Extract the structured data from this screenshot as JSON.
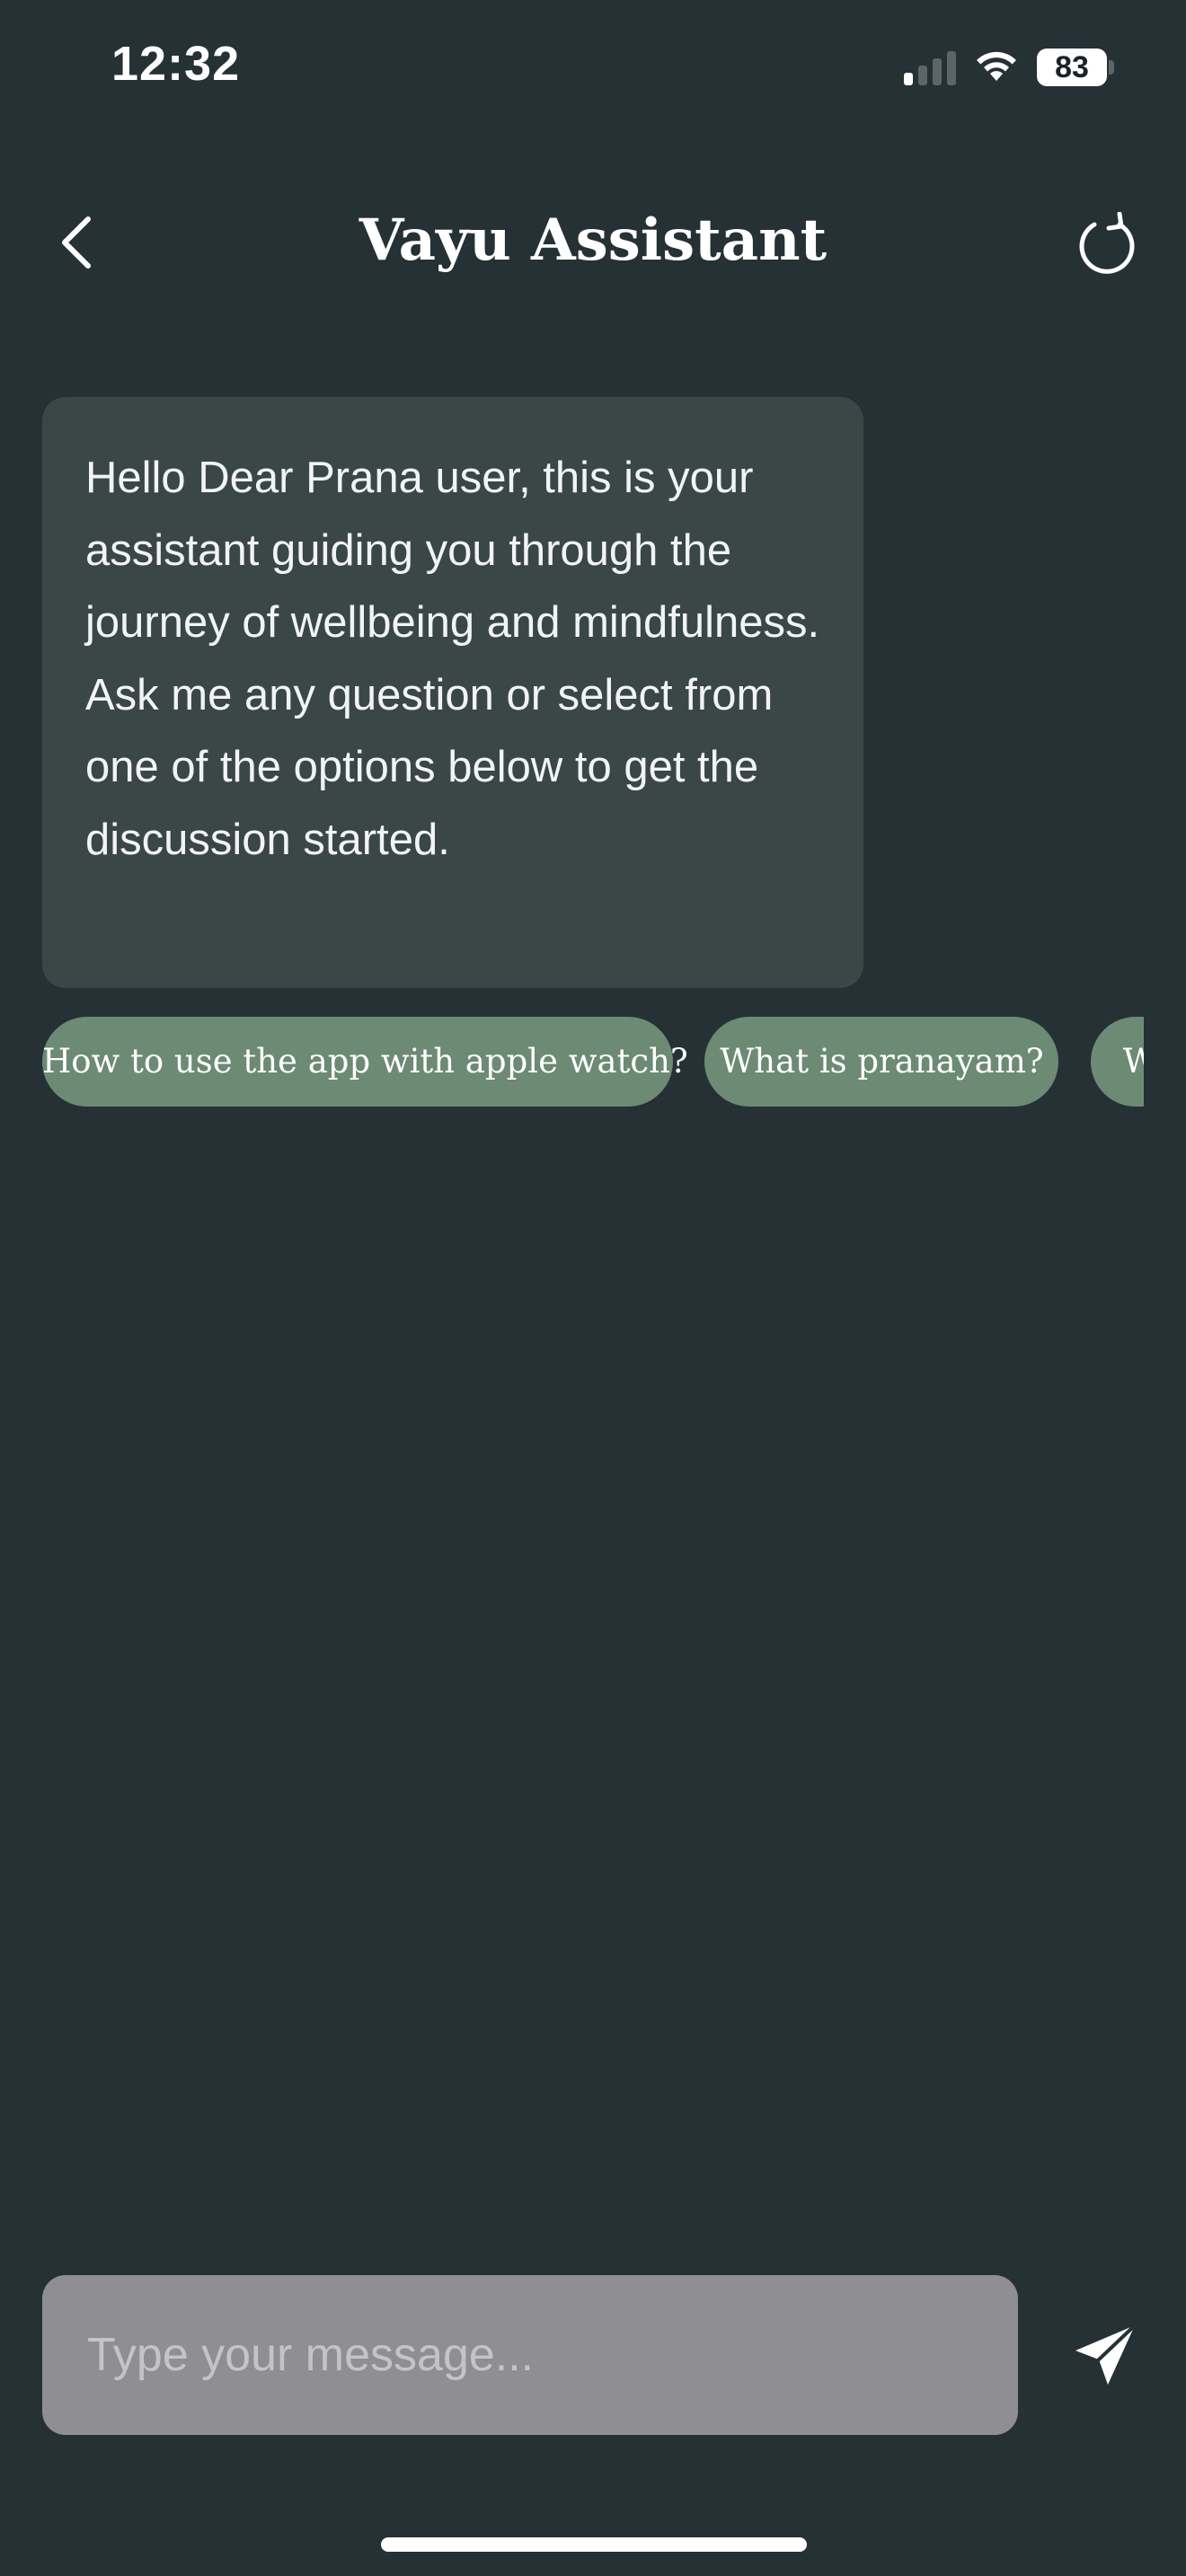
{
  "status_bar": {
    "time": "12:32",
    "battery_level": "83",
    "signal_bars_active": 1,
    "signal_bars_total": 4
  },
  "header": {
    "title": "Vayu Assistant",
    "back_icon": "chevron-left-icon",
    "refresh_icon": "refresh-icon"
  },
  "chat": {
    "assistant_message": "Hello Dear Prana user, this is your assistant guiding you through the journey of wellbeing and mindfulness. Ask me any question or select from one of the options below to get the discussion started."
  },
  "suggestions": [
    {
      "label": "How to use the app with apple watch?"
    },
    {
      "label": "What is pranayam?"
    },
    {
      "label": "W"
    }
  ],
  "composer": {
    "placeholder": "Type your message...",
    "value": "",
    "send_icon": "send-icon"
  },
  "colors": {
    "background": "#253135",
    "bubble": "#3b4747",
    "chip": "#6c8a74",
    "input": "#8e8e93"
  }
}
